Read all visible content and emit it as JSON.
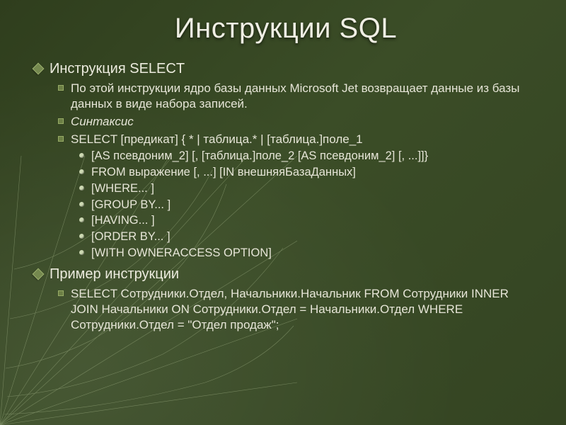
{
  "title": "Инструкции SQL",
  "section1": {
    "heading": "Инструкция SELECT",
    "desc": "По этой инструкции ядро базы данных Microsoft Jet возвращает данные из базы данных в виде набора записей.",
    "syntax_label": "Синтаксис",
    "syntax_lines": [
      "SELECT [предикат] { * | таблица.* | [таблица.]поле_1",
      "[AS псевдоним_2] [, [таблица.]поле_2 [AS псевдоним_2] [, ...]]}",
      "FROM выражение [, ...] [IN внешняяБазаДанных]",
      "[WHERE... ]",
      "[GROUP BY... ]",
      "[HAVING... ]",
      "[ORDER BY... ]",
      "[WITH OWNERACCESS OPTION]"
    ]
  },
  "section2": {
    "heading": "Пример инструкции",
    "example": "SELECT Сотрудники.Отдел, Начальники.Начальник FROM Сотрудники INNER JOIN Начальники ON Сотрудники.Отдел = Начальники.Отдел WHERE Сотрудники.Отдел = \"Отдел продаж\";"
  }
}
